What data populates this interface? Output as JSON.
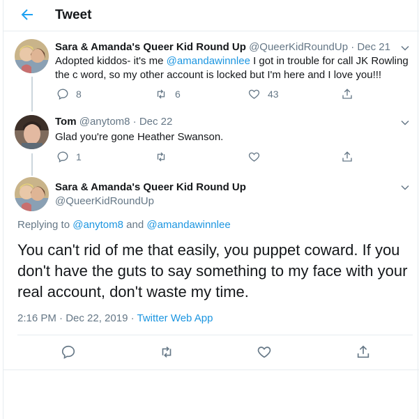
{
  "header": {
    "title": "Tweet"
  },
  "tweet1": {
    "name": "Sara & Amanda's Queer Kid Round Up",
    "handle": "@QueerKidRoundUp",
    "dot": " · ",
    "date": "Dec 21",
    "text_a": "Adopted kiddos- it's me ",
    "mention": "@amandawinnlee",
    "text_b": " I got in trouble for call JK Rowling the c word, so my other account is locked but I'm here and I love you!!!",
    "replies": "8",
    "retweets": "6",
    "likes": "43"
  },
  "tweet2": {
    "name": "Tom",
    "handle": "@anytom8",
    "dot": " · ",
    "date": "Dec 22",
    "text": "Glad you're gone Heather Swanson.",
    "replies": "1"
  },
  "main": {
    "name": "Sara & Amanda's Queer Kid Round Up",
    "handle": "@QueerKidRoundUp",
    "replying_prefix": "Replying to ",
    "replying_user1": "@anytom8",
    "replying_and": " and ",
    "replying_user2": "@amandawinnlee",
    "text": "You can't rid of me that easily, you puppet coward. If you don't have the guts to say something to my face with your real account, don't waste my time.",
    "time": "2:16 PM · Dec 22, 2019 · ",
    "source": "Twitter Web App"
  },
  "colors": {
    "accent": "#1b95e0",
    "muted": "#657786",
    "border": "#e6ecf0"
  }
}
